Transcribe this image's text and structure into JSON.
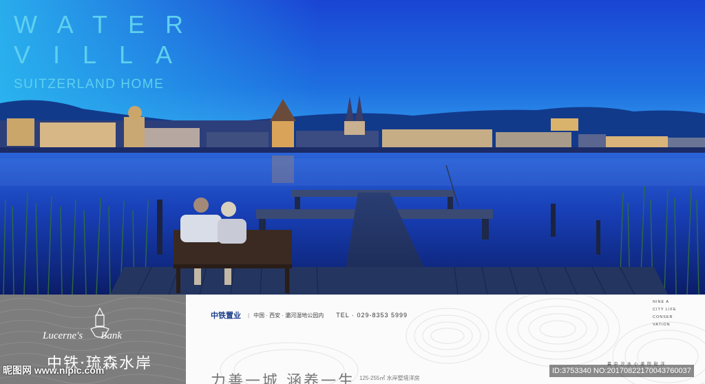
{
  "hero": {
    "headline_line1": "WATER",
    "headline_line2": "VILLA",
    "headline_line3": "SUITZERLAND HOME"
  },
  "brand": {
    "name_en_1": "Lucerne's",
    "name_en_2": "Bank",
    "name_cn": "中铁·琉森水岸"
  },
  "developer": {
    "logo_text": "中铁置业",
    "location": "中国 · 西安 · 灞河湿地公园内",
    "tel": "TEL · 029-8353 5999"
  },
  "slogan": {
    "main": "力善一城  涵养一生",
    "area": "125-255㎡ 水岸墅境洋房"
  },
  "vertical_en": [
    "NINE A",
    "CITY LIFE",
    "CONSER",
    "VATION"
  ],
  "vertical_cn": "幕 中 汐 水 小 美 院 配 洋",
  "watermarks": {
    "left": "昵图网 www.nipic.com",
    "right": "ID:3753340 NO:20170822170043760037"
  },
  "colors": {
    "sky_top": "#1a3fd0",
    "headline": "#5fd0ef",
    "panel_grey": "#7d7d7d"
  }
}
